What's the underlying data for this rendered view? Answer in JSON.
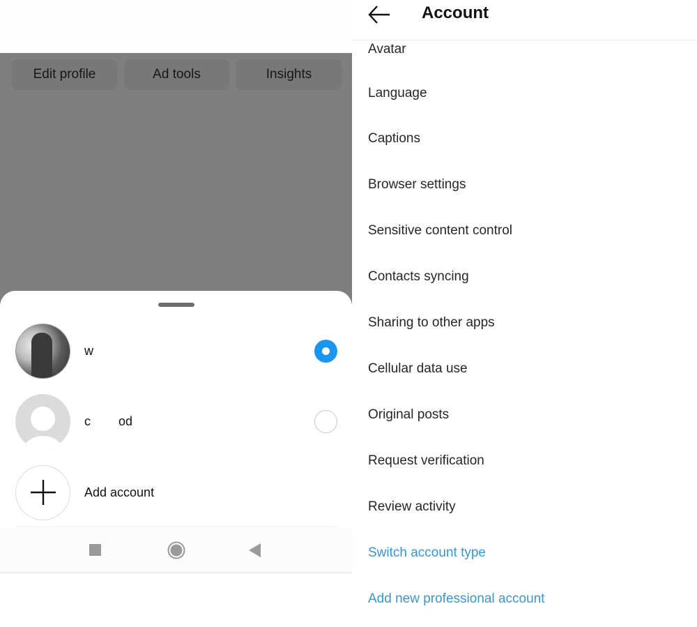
{
  "profile_buttons": [
    "Edit profile",
    "Ad tools",
    "Insights"
  ],
  "account_switcher": {
    "accounts": [
      {
        "name": "w",
        "selected": true,
        "avatar": "photo"
      },
      {
        "name": "c        od",
        "selected": false,
        "avatar": "default-avatar"
      }
    ],
    "add_account_label": "Add account",
    "selected_color": "#1a95f0"
  },
  "system_nav": {
    "buttons": [
      "recents-icon",
      "home-icon",
      "back-icon"
    ]
  },
  "settings": {
    "title": "Account",
    "items": [
      "Avatar",
      "Language",
      "Captions",
      "Browser settings",
      "Sensitive content control",
      "Contacts syncing",
      "Sharing to other apps",
      "Cellular data use",
      "Original posts",
      "Request verification",
      "Review activity"
    ],
    "links": [
      "Switch account type",
      "Add new professional account"
    ],
    "link_color": "#3897cf"
  }
}
